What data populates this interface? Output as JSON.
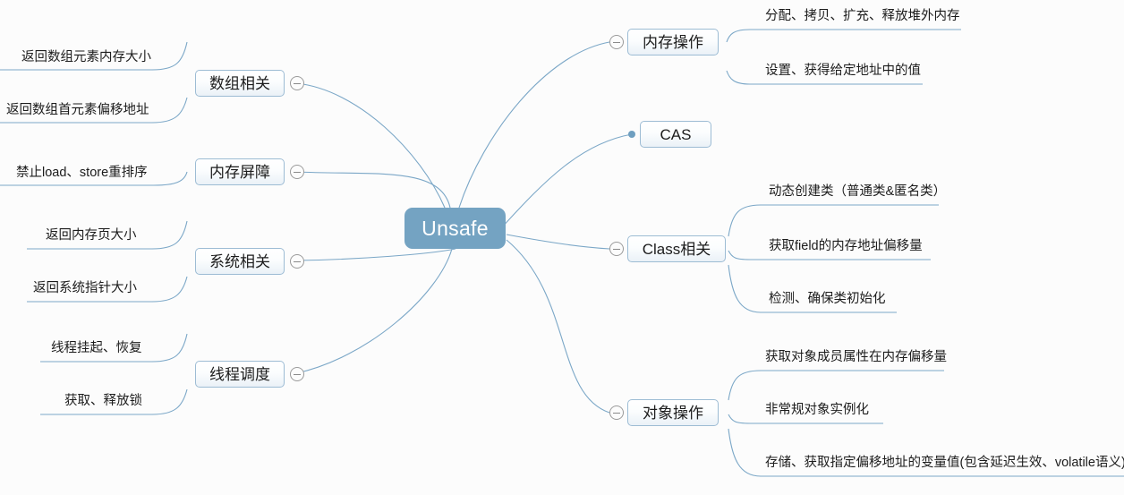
{
  "diagram": {
    "type": "mind-map",
    "background_color": "#fcfcfc",
    "root_color": "#74a3c2",
    "edge_color": "#7ba7c7",
    "node_border_color": "#9dbcd4",
    "root": {
      "label": "Unsafe"
    },
    "branches": [
      {
        "id": "array",
        "label": "数组相关",
        "side": "left",
        "toggle": "collapse-minus",
        "children": [
          {
            "label": "返回数组元素内存大小"
          },
          {
            "label": "返回数组首元素偏移地址"
          }
        ]
      },
      {
        "id": "memory-barrier",
        "label": "内存屏障",
        "side": "left",
        "toggle": "collapse-minus",
        "children": [
          {
            "label": "禁止load、store重排序"
          }
        ]
      },
      {
        "id": "system",
        "label": "系统相关",
        "side": "left",
        "toggle": "collapse-minus",
        "children": [
          {
            "label": "返回内存页大小"
          },
          {
            "label": "返回系统指针大小"
          }
        ]
      },
      {
        "id": "thread-scheduling",
        "label": "线程调度",
        "side": "left",
        "toggle": "collapse-minus",
        "children": [
          {
            "label": "线程挂起、恢复"
          },
          {
            "label": "获取、释放锁"
          }
        ]
      },
      {
        "id": "memory-operation",
        "label": "内存操作",
        "side": "right",
        "toggle": "collapse-minus",
        "children": [
          {
            "label": "分配、拷贝、扩充、释放堆外内存"
          },
          {
            "label": "设置、获得给定地址中的值"
          }
        ]
      },
      {
        "id": "cas",
        "label": "CAS",
        "side": "right",
        "toggle": "leaf-dot",
        "children": []
      },
      {
        "id": "class",
        "label": "Class相关",
        "side": "right",
        "toggle": "collapse-minus",
        "children": [
          {
            "label": "动态创建类（普通类&匿名类）"
          },
          {
            "label": "获取field的内存地址偏移量"
          },
          {
            "label": "检测、确保类初始化"
          }
        ]
      },
      {
        "id": "object-operation",
        "label": "对象操作",
        "side": "right",
        "toggle": "collapse-minus",
        "children": [
          {
            "label": "获取对象成员属性在内存偏移量"
          },
          {
            "label": "非常规对象实例化"
          },
          {
            "label": "存储、获取指定偏移地址的变量值(包含延迟生效、volatile语义)"
          }
        ]
      }
    ]
  }
}
